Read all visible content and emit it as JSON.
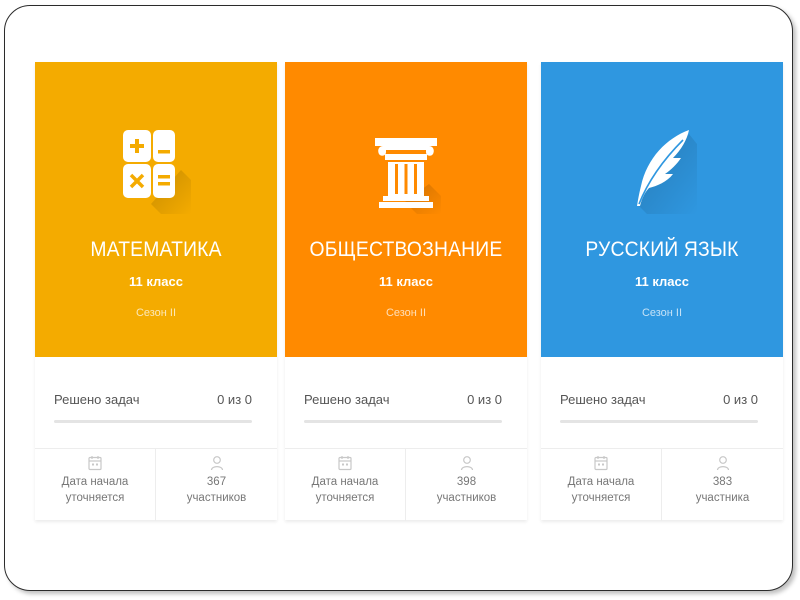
{
  "colors": {
    "math": "#f4ab00",
    "social": "#ff8a00",
    "russian": "#2f97e0"
  },
  "cards": [
    {
      "subject": "МАТЕМАТИКА",
      "grade": "11 класс",
      "season": "Сезон II",
      "icon": "calculator-icon",
      "progress_label": "Решено задач",
      "progress_value": "0 из 0",
      "progress_fraction": 0,
      "date_label_1": "Дата начала",
      "date_label_2": "уточняется",
      "participants_count": "367",
      "participants_label": "участников"
    },
    {
      "subject": "ОБЩЕСТВОЗНАНИЕ",
      "grade": "11 класс",
      "season": "Сезон II",
      "icon": "column-icon",
      "progress_label": "Решено задач",
      "progress_value": "0 из 0",
      "progress_fraction": 0,
      "date_label_1": "Дата начала",
      "date_label_2": "уточняется",
      "participants_count": "398",
      "participants_label": "участников"
    },
    {
      "subject": "РУССКИЙ ЯЗЫК",
      "grade": "11 класс",
      "season": "Сезон II",
      "icon": "quill-icon",
      "progress_label": "Решено задач",
      "progress_value": "0 из 0",
      "progress_fraction": 0,
      "date_label_1": "Дата начала",
      "date_label_2": "уточняется",
      "participants_count": "383",
      "participants_label": "участника"
    }
  ]
}
